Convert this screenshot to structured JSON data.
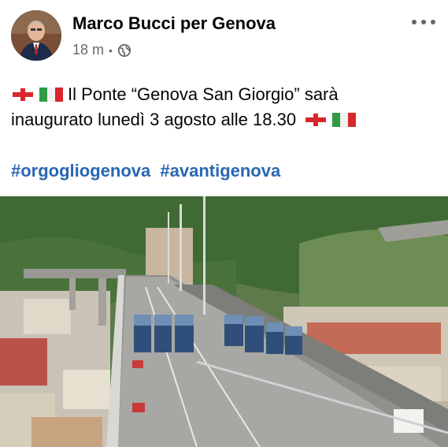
{
  "post": {
    "author": "Marco Bucci per Genova",
    "time": "18 m",
    "separator": "•",
    "audience_icon": "globe-icon",
    "more_icon": "more-options-icon",
    "text_line1": "Il Ponte “Genova San Giorgio” sarà",
    "text_line2": "inaugurato lunedì 3 agosto alle 18.30",
    "hashtags": [
      "#orgogliogenova",
      "#avantigenova"
    ]
  },
  "colors": {
    "hashtag": "#2a67b2",
    "meta": "#65676b"
  }
}
